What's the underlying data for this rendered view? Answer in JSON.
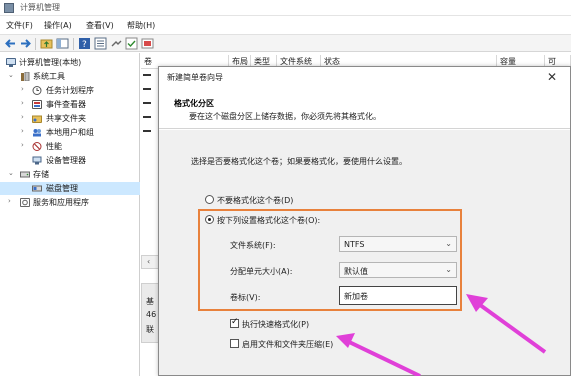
{
  "window": {
    "title": "计算机管理"
  },
  "menu": [
    "文件(F)",
    "操作(A)",
    "查看(V)",
    "帮助(H)"
  ],
  "tree": {
    "root": "计算机管理(本地)",
    "system_tools": "系统工具",
    "task_scheduler": "任务计划程序",
    "event_viewer": "事件查看器",
    "shared_folders": "共享文件夹",
    "local_users": "本地用户和组",
    "performance": "性能",
    "device_manager": "设备管理器",
    "storage": "存储",
    "disk_management": "磁盘管理",
    "services": "服务和应用程序"
  },
  "list": {
    "columns": [
      "卷",
      "布局",
      "类型",
      "文件系统",
      "状态",
      "容量",
      "可"
    ],
    "disk_lines": [
      "基",
      "46",
      "联"
    ]
  },
  "wizard": {
    "title": "新建简单卷向导",
    "close": "✕",
    "heading": "格式化分区",
    "subheading": "要在这个磁盘分区上储存数据，你必须先将其格式化。",
    "prompt": "选择是否要格式化这个卷；如果要格式化，要使用什么设置。",
    "opt_no_format": "不要格式化这个卷(D)",
    "opt_format": "按下列设置格式化这个卷(O):",
    "fs_label": "文件系统(F):",
    "fs_value": "NTFS",
    "alloc_label": "分配单元大小(A):",
    "alloc_value": "默认值",
    "vol_label": "卷标(V):",
    "vol_value": "新加卷",
    "quick_format": "执行快速格式化(P)",
    "compression": "启用文件和文件夹压缩(E)"
  },
  "colors": {
    "highlight": "#e8813c",
    "arrow": "#e040d8",
    "selection": "#cce8ff"
  }
}
